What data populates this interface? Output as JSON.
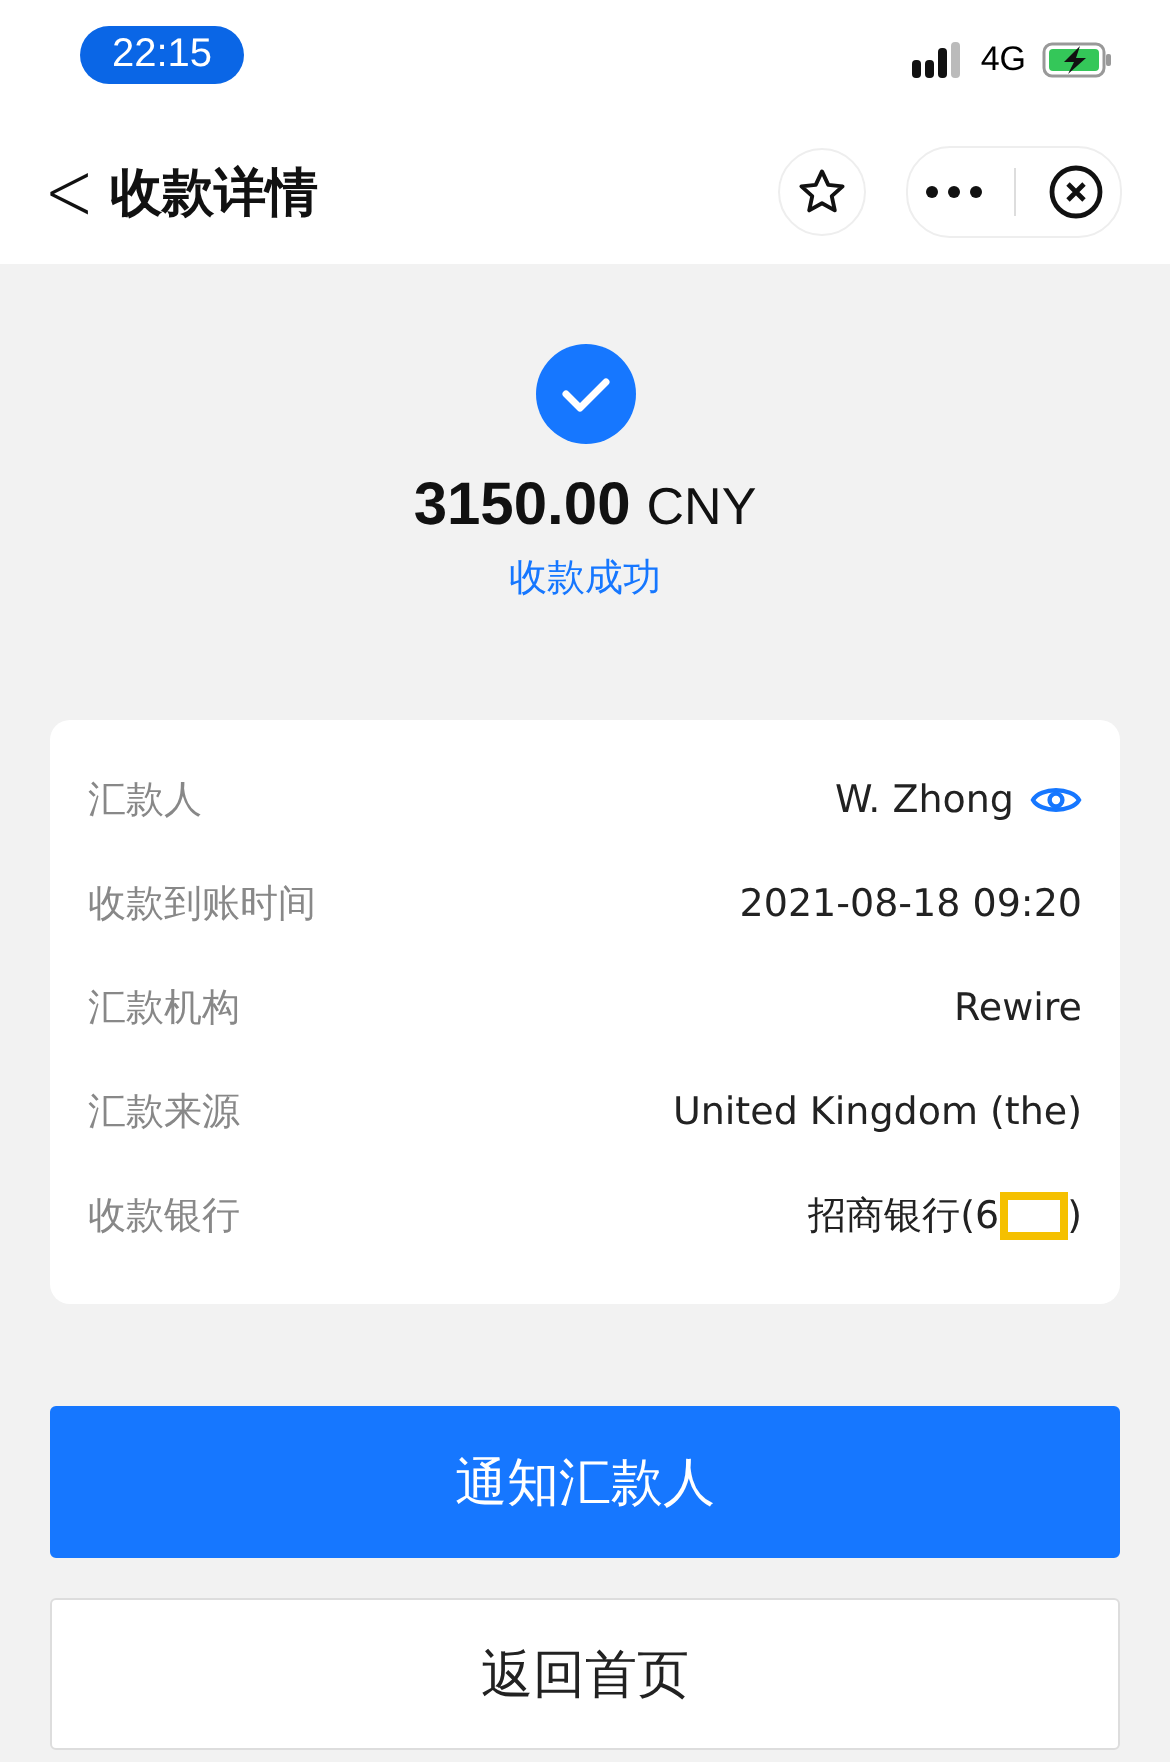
{
  "status_bar": {
    "time": "22:15",
    "network": "4G"
  },
  "nav": {
    "back_icon": "<",
    "title": "收款详情"
  },
  "result": {
    "amount": "3150.00",
    "currency": "CNY",
    "status": "收款成功"
  },
  "details": [
    {
      "label": "汇款人",
      "value": "W. Zhong",
      "kind": "reveal"
    },
    {
      "label": "收款到账时间",
      "value": "2021-08-18 09:20",
      "kind": "plain"
    },
    {
      "label": "汇款机构",
      "value": "Rewire",
      "kind": "plain"
    },
    {
      "label": "汇款来源",
      "value": "United Kingdom (the)",
      "kind": "plain"
    },
    {
      "label": "收款银行",
      "value": "招商银行(6",
      "suffix": ")",
      "kind": "redacted"
    }
  ],
  "buttons": [
    {
      "label": "通知汇款人",
      "kind": "primary"
    },
    {
      "label": "返回首页",
      "kind": "secondary"
    }
  ]
}
